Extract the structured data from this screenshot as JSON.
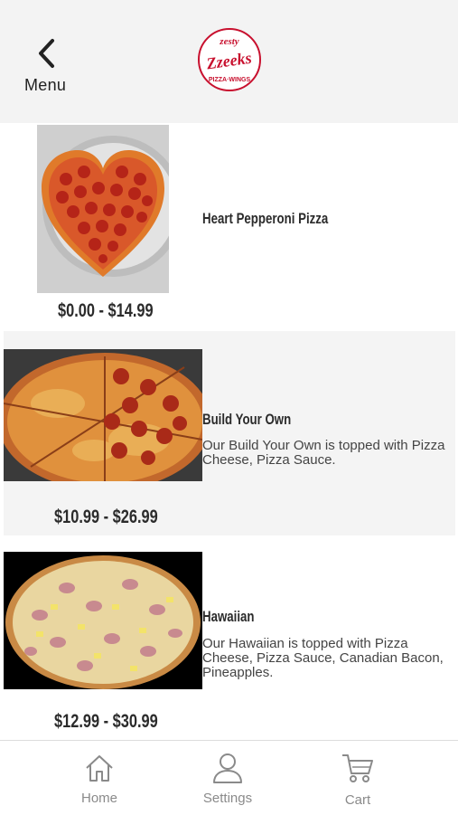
{
  "header": {
    "back_label": "Menu",
    "logo": {
      "top": "zesty",
      "main": "Zzeeks",
      "bottom": "PIZZA·WINGS",
      "color": "#c8102e"
    }
  },
  "products": [
    {
      "name": "Heart Pepperoni Pizza",
      "description": "",
      "price": "$0.00 - $14.99",
      "image": "heart-pepperoni-pizza"
    },
    {
      "name": "Build Your Own",
      "description": "Our Build Your Own is topped with Pizza Cheese, Pizza Sauce.",
      "price": "$10.99 - $26.99",
      "image": "pepperoni-pizza"
    },
    {
      "name": "Hawaiian",
      "description": "Our Hawaiian is topped with Pizza Cheese, Pizza Sauce, Canadian Bacon, Pineapples.",
      "price": "$12.99 - $30.99",
      "image": "hawaiian-pizza"
    }
  ],
  "tabs": [
    {
      "label": "Home",
      "icon": "home-icon"
    },
    {
      "label": "Settings",
      "icon": "user-icon"
    },
    {
      "label": "Cart",
      "icon": "cart-icon"
    }
  ],
  "colors": {
    "header_bg": "#f3f3f3",
    "row_shade": "#f4f4f4",
    "tab_icon": "#8a8a8a"
  }
}
